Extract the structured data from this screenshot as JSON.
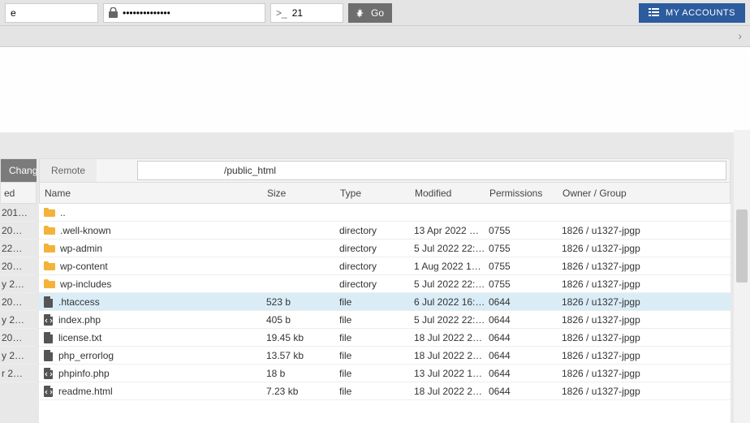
{
  "top": {
    "host": "e",
    "password": "••••••••••••••",
    "port_prefix": ">_",
    "port": "21",
    "go_label": "Go",
    "accounts_label": "MY ACCOUNTS"
  },
  "panel": {
    "change_label": "Change",
    "remote_label": "Remote",
    "path_suffix": "/public_html"
  },
  "columns": {
    "name": "Name",
    "size": "Size",
    "type": "Type",
    "modified": "Modified",
    "permissions": "Permissions",
    "owner": "Owner / Group"
  },
  "local": {
    "head": "ed",
    "rows": [
      "201…",
      "20…",
      "22…",
      "20…",
      "y 2…",
      "20…",
      "y 2…",
      "20…",
      "y 2…",
      "r 2…"
    ]
  },
  "files": [
    {
      "icon": "folder-open",
      "name": "..",
      "size": "",
      "type": "",
      "modified": "",
      "perm": "",
      "owner": "",
      "selected": false
    },
    {
      "icon": "folder",
      "name": ".well-known",
      "size": "",
      "type": "directory",
      "modified": "13 Apr 2022 …",
      "perm": "0755",
      "owner": "1826 / u1327-jpgp",
      "selected": false
    },
    {
      "icon": "folder",
      "name": "wp-admin",
      "size": "",
      "type": "directory",
      "modified": "5 Jul 2022 22:…",
      "perm": "0755",
      "owner": "1826 / u1327-jpgp",
      "selected": false
    },
    {
      "icon": "folder",
      "name": "wp-content",
      "size": "",
      "type": "directory",
      "modified": "1 Aug 2022 1…",
      "perm": "0755",
      "owner": "1826 / u1327-jpgp",
      "selected": false
    },
    {
      "icon": "folder",
      "name": "wp-includes",
      "size": "",
      "type": "directory",
      "modified": "5 Jul 2022 22:…",
      "perm": "0755",
      "owner": "1826 / u1327-jpgp",
      "selected": false
    },
    {
      "icon": "file",
      "name": ".htaccess",
      "size": "523 b",
      "type": "file",
      "modified": "6 Jul 2022 16:…",
      "perm": "0644",
      "owner": "1826 / u1327-jpgp",
      "selected": true
    },
    {
      "icon": "file-code",
      "name": "index.php",
      "size": "405 b",
      "type": "file",
      "modified": "5 Jul 2022 22:…",
      "perm": "0644",
      "owner": "1826 / u1327-jpgp",
      "selected": false
    },
    {
      "icon": "file",
      "name": "license.txt",
      "size": "19.45 kb",
      "type": "file",
      "modified": "18 Jul 2022 2…",
      "perm": "0644",
      "owner": "1826 / u1327-jpgp",
      "selected": false
    },
    {
      "icon": "file",
      "name": "php_errorlog",
      "size": "13.57 kb",
      "type": "file",
      "modified": "18 Jul 2022 2…",
      "perm": "0644",
      "owner": "1826 / u1327-jpgp",
      "selected": false
    },
    {
      "icon": "file-code",
      "name": "phpinfo.php",
      "size": "18 b",
      "type": "file",
      "modified": "13 Jul 2022 1…",
      "perm": "0644",
      "owner": "1826 / u1327-jpgp",
      "selected": false
    },
    {
      "icon": "file-code",
      "name": "readme.html",
      "size": "7.23 kb",
      "type": "file",
      "modified": "18 Jul 2022 2…",
      "perm": "0644",
      "owner": "1826 / u1327-jpgp",
      "selected": false
    }
  ]
}
